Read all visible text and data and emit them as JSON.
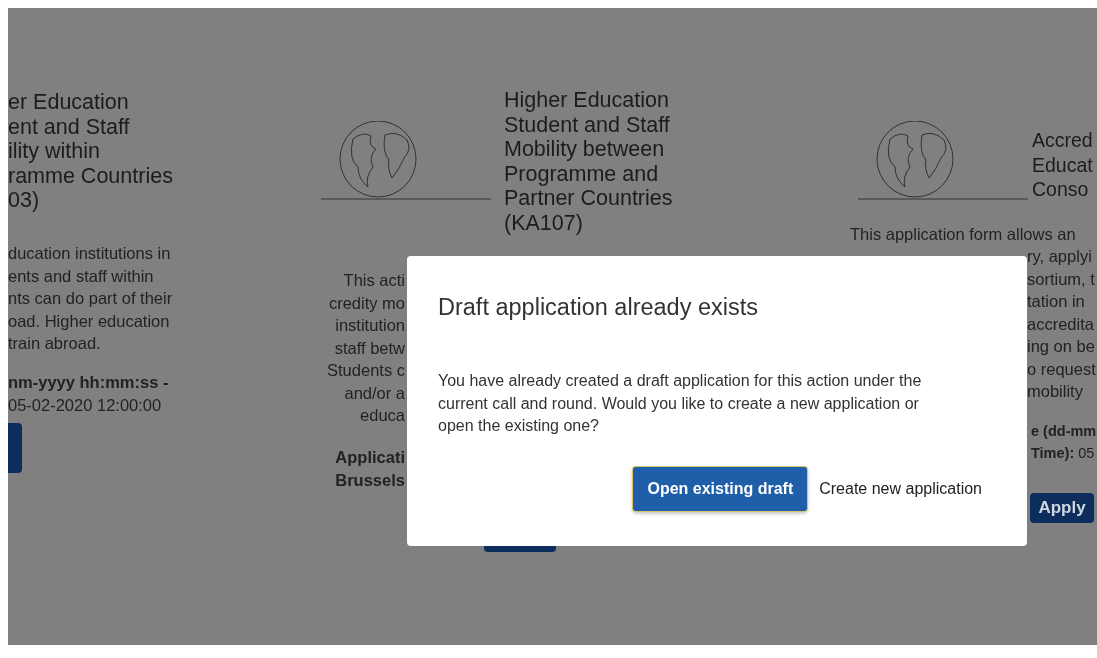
{
  "cards": [
    {
      "title_lines": [
        "er Education",
        "ent and Staff",
        "ility within",
        "ramme Countries",
        "03)"
      ],
      "has_image": false,
      "description_lines": [
        "ducation institutions in",
        "ents and staff within",
        "nts can do part of their",
        "oad. Higher education",
        "train abroad."
      ],
      "deadline_lines": [
        "**nm-yyyy hh:mm:ss -**",
        "05-02-2020 12:00:00"
      ]
    },
    {
      "title_lines": [
        "Higher Education",
        "Student and Staff",
        "Mobility between",
        "Programme and",
        "Partner Countries",
        "(KA107)"
      ],
      "has_image": true,
      "description_lines": [
        "This acti",
        "credity mo",
        "institution",
        "staff betw",
        "Students c",
        "and/or a",
        "educa"
      ],
      "deadline_lines": [
        "**Applicati**",
        "**Brussels**"
      ]
    },
    {
      "title_lines": [
        "Accred",
        "Educat",
        "Conso"
      ],
      "has_image": true,
      "description_lines": [
        "This application form allows an",
        "ry, applyi",
        "sortium, t",
        "tation in",
        "accredita",
        "ing on be",
        "o request",
        "mobility"
      ],
      "deadline_lines": [
        "**e (dd-mm**",
        "**Time):** 05"
      ],
      "apply_button": {
        "label": "Apply"
      }
    }
  ],
  "modal": {
    "title": "Draft application already exists",
    "message": "You have already created a draft application for this action under the current call and round. Would you like to create a new application or open the existing one?",
    "buttons": [
      {
        "label": "Open existing draft",
        "kind": "primary"
      },
      {
        "label": "Create new application",
        "kind": "plain"
      }
    ]
  }
}
